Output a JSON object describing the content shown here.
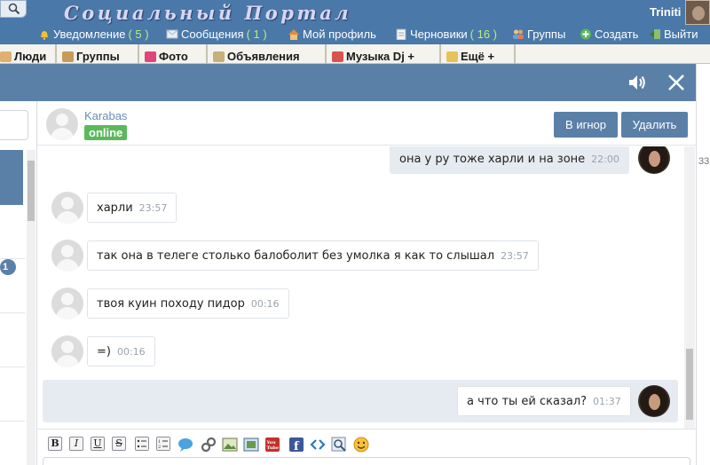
{
  "site": {
    "title": "Социальный Портал",
    "user_name": "Triniti",
    "nav": [
      {
        "label": "Уведомление",
        "count": "( 5 )",
        "icon": "bell-icon"
      },
      {
        "label": "Сообщения",
        "count": "( 1 )",
        "icon": "envelope-icon"
      },
      {
        "label": "Мой профиль",
        "count": "",
        "icon": "home-icon"
      },
      {
        "label": "Черновики",
        "count": "( 16 )",
        "icon": "draft-icon"
      },
      {
        "label": "Группы",
        "count": "",
        "icon": "people-icon"
      },
      {
        "label": "Создать",
        "count": "",
        "icon": "plus-icon"
      },
      {
        "label": "Выйти",
        "count": "",
        "icon": "logout-icon"
      }
    ]
  },
  "tabs": [
    {
      "label": "Люди"
    },
    {
      "label": "Группы"
    },
    {
      "label": "Фото"
    },
    {
      "label": "Объявления"
    },
    {
      "label": "Музыка Dj +"
    },
    {
      "label": "Ещё +"
    }
  ],
  "contacts": {
    "unread_badge": "1"
  },
  "side_peek_number": "33",
  "chat": {
    "contact_name": "Karabas",
    "status": "online",
    "ignore_label": "В игнор",
    "delete_label": "Удалить",
    "messages": [
      {
        "direction": "out",
        "text": "она у ру тоже харли и на зоне",
        "time": "22:00"
      },
      {
        "direction": "in",
        "text": "харли",
        "time": "23:57"
      },
      {
        "direction": "in",
        "text": "так она в телеге столько балоболит без умолка я как то слышал",
        "time": "23:57"
      },
      {
        "direction": "in",
        "text": "твоя куин походу пидор",
        "time": "00:16"
      },
      {
        "direction": "in",
        "text": "=)",
        "time": "00:16"
      },
      {
        "direction": "out",
        "text": "а что ты ей сказал?",
        "time": "01:37"
      }
    ]
  },
  "toolbar": {
    "bold": "B",
    "italic": "I",
    "underline": "U",
    "strike": "S"
  },
  "colors": {
    "header_blue": "#5b80a8",
    "online_green": "#5cb85c",
    "counter_green": "#b8f07a"
  }
}
